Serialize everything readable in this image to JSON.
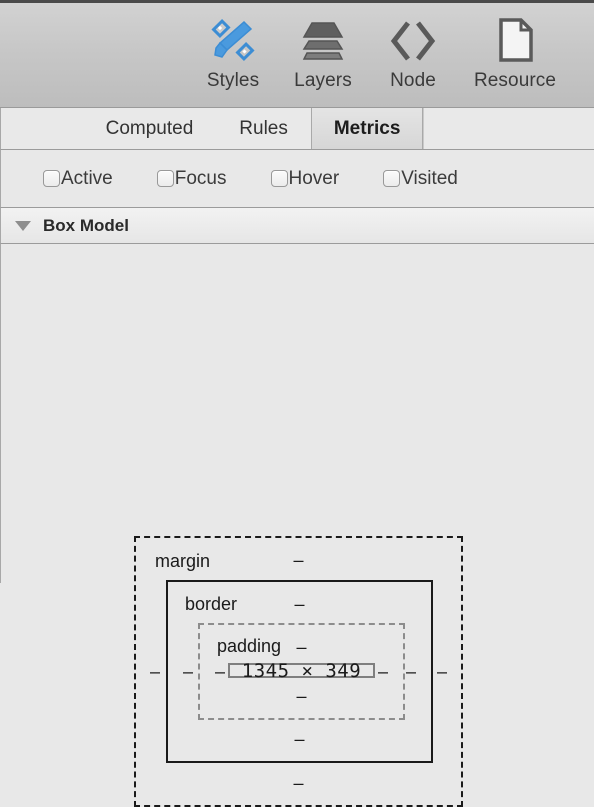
{
  "toolbar": {
    "items": [
      {
        "label": "Styles",
        "icon": "paintbrush-ruler-icon"
      },
      {
        "label": "Layers",
        "icon": "stacked-layers-icon"
      },
      {
        "label": "Node",
        "icon": "angle-brackets-icon"
      },
      {
        "label": "Resource",
        "icon": "document-page-icon"
      }
    ]
  },
  "tabs": {
    "items": [
      {
        "label": "Computed",
        "selected": false
      },
      {
        "label": "Rules",
        "selected": false
      },
      {
        "label": "Metrics",
        "selected": true
      }
    ]
  },
  "pseudo_states": {
    "items": [
      {
        "label": "Active",
        "checked": false
      },
      {
        "label": "Focus",
        "checked": false
      },
      {
        "label": "Hover",
        "checked": false
      },
      {
        "label": "Visited",
        "checked": false
      }
    ]
  },
  "section": {
    "title": "Box Model",
    "expanded": true,
    "disclosure_icon": "triangle-down-icon"
  },
  "box_model": {
    "margin": {
      "name": "margin",
      "top": "–",
      "right": "–",
      "bottom": "–",
      "left": "–"
    },
    "border": {
      "name": "border",
      "top": "–",
      "right": "–",
      "bottom": "–",
      "left": "–"
    },
    "padding": {
      "name": "padding",
      "top": "–",
      "right": "–",
      "bottom": "–",
      "left": "–"
    },
    "content": {
      "size": "1345 × 349"
    }
  },
  "colors": {
    "panel_background": "#e8e8e8",
    "toolbar_background": "#c6c6c6",
    "accent_blue": "#3c8dd4",
    "margin_stroke": "#1a1a1a",
    "border_stroke": "#1a1a1a",
    "padding_stroke": "#8c8c8c",
    "content_stroke": "#7f7f7f"
  }
}
